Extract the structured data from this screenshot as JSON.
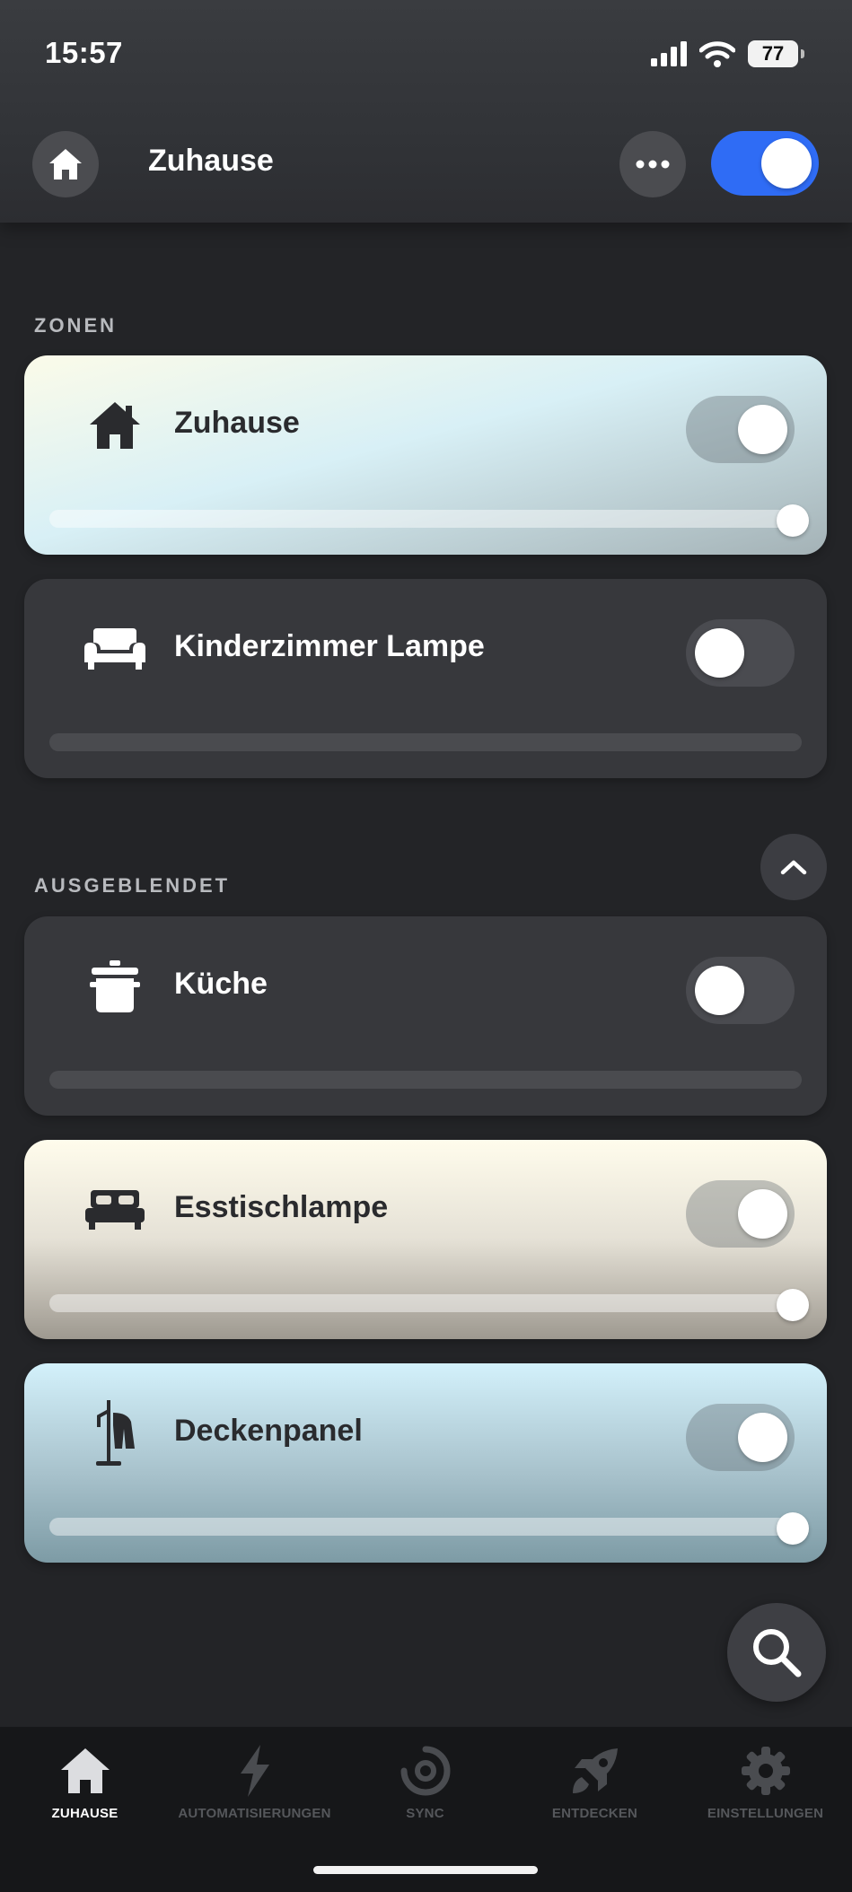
{
  "status_bar": {
    "time": "15:57",
    "battery": "77"
  },
  "header": {
    "title": "Zuhause",
    "master_toggle_on": true
  },
  "sections": {
    "zones_label": "ZONEN",
    "hidden_label": "AUSGEBLENDET"
  },
  "cards": [
    {
      "name": "Zuhause",
      "icon": "house-icon",
      "on": true,
      "brightness": 1.0
    },
    {
      "name": "Kinderzimmer Lampe",
      "icon": "sofa-icon",
      "on": false,
      "brightness": 0
    },
    {
      "name": "Küche",
      "icon": "cooking-pot-icon",
      "on": false,
      "brightness": 0
    },
    {
      "name": "Esstischlampe",
      "icon": "bed-icon",
      "on": true,
      "brightness": 1.0
    },
    {
      "name": "Deckenpanel",
      "icon": "coat-rack-icon",
      "on": true,
      "brightness": 1.0
    }
  ],
  "colors": {
    "accent": "#2f6cf5",
    "background": "#232427",
    "card_off": "#37383c",
    "card_zuhause_gradient": [
      "#fbfbe9",
      "#d8f0f6",
      "#a4b2b6"
    ],
    "card_esstisch_gradient": [
      "#fffcec",
      "#e5e1d6",
      "#9e9990"
    ],
    "card_decken_gradient": [
      "#d3f1fb",
      "#a8c2cc",
      "#7d9ba5"
    ]
  },
  "bottom_nav": [
    {
      "label": "ZUHAUSE",
      "icon": "home-icon",
      "active": true
    },
    {
      "label": "AUTOMATISIERUNGEN",
      "icon": "lightning-icon",
      "active": false
    },
    {
      "label": "SYNC",
      "icon": "sync-icon",
      "active": false
    },
    {
      "label": "ENTDECKEN",
      "icon": "rocket-icon",
      "active": false
    },
    {
      "label": "EINSTELLUNGEN",
      "icon": "gear-icon",
      "active": false
    }
  ]
}
